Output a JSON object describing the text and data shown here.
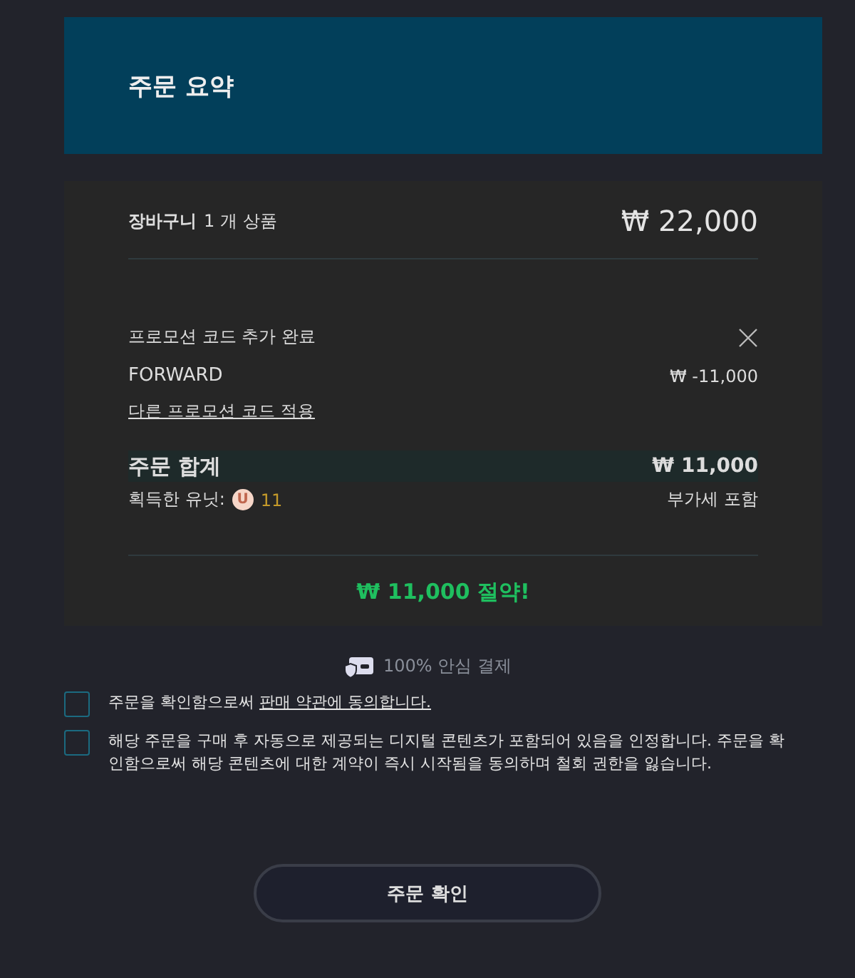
{
  "header": {
    "title": "주문 요약"
  },
  "cart": {
    "label": "장바구니",
    "count": "1 개 상품",
    "total": "₩ 22,000"
  },
  "promo": {
    "status": "프로모션 코드 추가 완료",
    "code": "FORWARD",
    "discount": "₩ -11,000",
    "other_link": "다른 프로모션 코드 적용"
  },
  "order_total": {
    "label": "주문 합계",
    "value": "₩ 11,000",
    "units_label": "획득한 유닛:",
    "units_icon": "U",
    "units": "11",
    "tax_note": "부가세 포함"
  },
  "savings": "₩ 11,000 절약!",
  "secure_payment": "100% 안심 결제",
  "agreements": [
    {
      "text": "주문을 확인함으로써 ",
      "link": "판매 약관에 동의합니다.",
      "checked": false
    },
    {
      "text": "해당 주문을 구매 후 자동으로 제공되는 디지털 콘텐츠가 포함되어 있음을 인정합니다. 주문을 확인함으로써 해당 콘텐츠에 대한 계약이 즉시 시작됨을 동의하며 철회 권한을 잃습니다.",
      "checked": false
    }
  ],
  "confirm_button": "주문 확인"
}
